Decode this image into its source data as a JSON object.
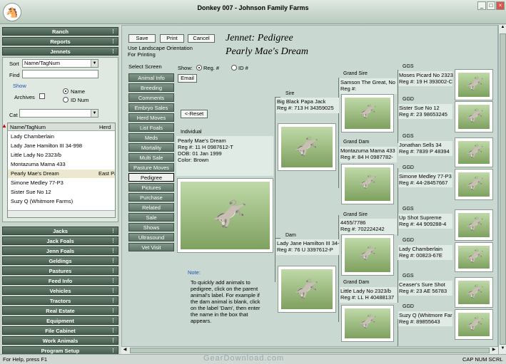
{
  "window": {
    "title": "Donkey 007 - Johnson Family Farms",
    "app_icon": "donkey-icon"
  },
  "left_nav_top": [
    "Ranch",
    "Reports",
    "Jennets"
  ],
  "left_nav_bottom": [
    "Jacks",
    "Jack Foals",
    "Jenn Foals",
    "Geldings",
    "Pastures",
    "Feed Info",
    "Vehicles",
    "Tractors",
    "Real Estate",
    "Equipment",
    "File Cabinet",
    "Work Animals",
    "Program Setup"
  ],
  "filters": {
    "sort_label": "Sort",
    "sort_value": "Name/TagNum",
    "find_label": "Find",
    "find_value": "",
    "show_label": "Show",
    "archives_label": "Archives",
    "name_radio": "Name",
    "idnum_radio": "ID Num",
    "cat_label": "Cat",
    "cat_value": ""
  },
  "list": {
    "col_name": "Name/TagNum",
    "col_herd": "Herd",
    "rows": [
      "Lady Chamberlain",
      "Lady Jane Hamilton III 34-998",
      "Little Lady No 2323/b",
      "Montazuma Mama 433",
      "Pearly Mae's Dream",
      "Simone Medley 77-P3",
      "Sister Sue No 12",
      "Suzy Q (Whitmore Farms)"
    ],
    "selected_herd": "East Pa"
  },
  "toolbar": {
    "save": "Save",
    "print": "Print",
    "cancel": "Cancel",
    "landscape_note": "Use Landscape Orientation For Printing"
  },
  "heading": {
    "line1": "Jennet: Pedigree",
    "line2": "Pearly Mae's Dream"
  },
  "select_screen_label": "Select Screen",
  "screens": [
    "Animal Info",
    "Breeding",
    "Comments",
    "Embryo Sales",
    "Herd Moves",
    "List Foals",
    "Meds",
    "Mortality",
    "Multi Sale",
    "Pasture Moves",
    "Pedigree",
    "Pictures",
    "Purchase",
    "Related",
    "Sale",
    "Shows",
    "Ultrasound",
    "Vet Visit"
  ],
  "active_screen": "Pedigree",
  "show_opts": {
    "label": "Show:",
    "reg": "Reg. #",
    "id": "ID #",
    "email": "Email",
    "reset": "<-Reset"
  },
  "individual": {
    "label": "Individual",
    "lines": [
      "Pearly Mae's Dream",
      "Reg #: 11 H 0987612-T",
      "DOB: 01 Jan 1999",
      "Color: Brown"
    ]
  },
  "note": {
    "title": "Note:",
    "lines": [
      "To quickly add animals to",
      "pedigree, click on the parent",
      "animal's label. For example if",
      "the dam animal is blank, click",
      "on the label 'Dam', then enter",
      "the name in the box that",
      "appears."
    ]
  },
  "sire": {
    "label": "Sire",
    "name": "Big Black Papa Jack",
    "reg": "Reg #: 713 H 34359025"
  },
  "dam": {
    "label": "Dam",
    "name": "Lady Jane Hamilton III 34-",
    "reg": "Reg #: 76 U 3397612-P"
  },
  "grand_sire_1": {
    "label": "Grand Sire",
    "name": "Samson The Great, No",
    "reg": "Reg #:"
  },
  "grand_dam_1": {
    "label": "Grand Dam",
    "name": "Montazuma Mama 433",
    "reg": "Reg #: 84 H 0987782-"
  },
  "grand_sire_2": {
    "label": "Grand Sire",
    "name": "4455/7786",
    "reg": "Reg #: 702224242"
  },
  "grand_dam_2": {
    "label": "Grand Dam",
    "name": "Little Lady No 2323/b",
    "reg": "Reg #: LL H 40488137"
  },
  "ggs_1": {
    "label": "GGS",
    "name": "Moses Picard No 2323",
    "reg": "Reg #: 19 H 393002-C"
  },
  "ggd_1": {
    "label": "GGD",
    "name": "Sister Sue No 12",
    "reg": "Reg #: 23 98653245"
  },
  "ggs_2": {
    "label": "GGS",
    "name": "Jonathan Sells 34",
    "reg": "Reg #: 7839 P 48394"
  },
  "ggd_2": {
    "label": "GGD",
    "name": "Simone Medley 77-P3",
    "reg": "Reg #: 44-28457667"
  },
  "ggs_3": {
    "label": "GGS",
    "name": "Up Shot Supreme",
    "reg": "Reg #: 44 909288-4"
  },
  "ggd_3": {
    "label": "GGD",
    "name": "Lady Chamberlain",
    "reg": "Reg #: 00823-67E"
  },
  "ggs_4": {
    "label": "GGS",
    "name": "Ceaser's Sure Shot",
    "reg": "Reg #: 23 AE 56783"
  },
  "ggd_4": {
    "label": "GGD",
    "name": "Suzy Q (Whitmore Far",
    "reg": "Reg #: 89855643"
  },
  "status": {
    "help": "For Help, press F1",
    "indicators": "CAP  NUM  SCRL",
    "watermark": "GearDownload.com"
  },
  "colors": {
    "nav_bar": "#455b4c",
    "panel": "#c9d9d1"
  }
}
